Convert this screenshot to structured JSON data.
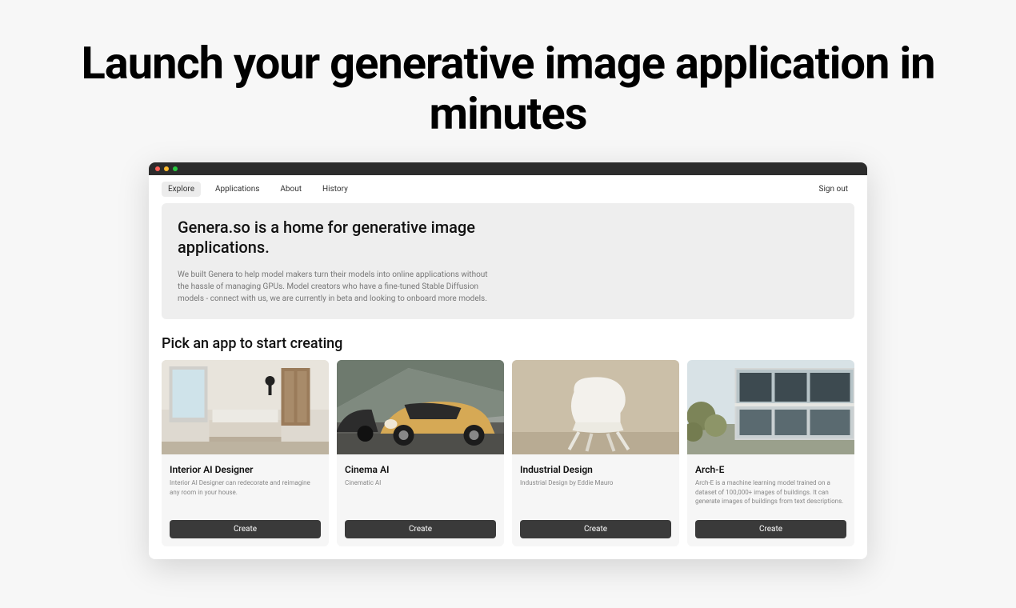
{
  "hero": {
    "headline": "Launch your generative image application in minutes"
  },
  "nav": {
    "items": [
      "Explore",
      "Applications",
      "About",
      "History"
    ],
    "active": "Explore",
    "signout": "Sign out"
  },
  "intro": {
    "title": "Genera.so is a home for generative image applications.",
    "body": "We built Genera to help model makers turn their models into online applications without the hassle of managing GPUs. Model creators who have a fine-tuned Stable Diffusion models - connect with us, we are currently in beta and looking to onboard more models."
  },
  "section": {
    "pick": "Pick an app to start creating"
  },
  "cards": [
    {
      "title": "Interior AI Designer",
      "desc": "Interior AI Designer can redecorate and reimagine any room in your house.",
      "button": "Create"
    },
    {
      "title": "Cinema AI",
      "desc": "Cinematic AI",
      "button": "Create"
    },
    {
      "title": "Industrial Design",
      "desc": "Industrial Design by Eddie Mauro",
      "button": "Create"
    },
    {
      "title": "Arch-E",
      "desc": "Arch-E is a machine learning model trained on a dataset of 100,000+ images of buildings. It can generate images of buildings from text descriptions.",
      "button": "Create"
    }
  ]
}
